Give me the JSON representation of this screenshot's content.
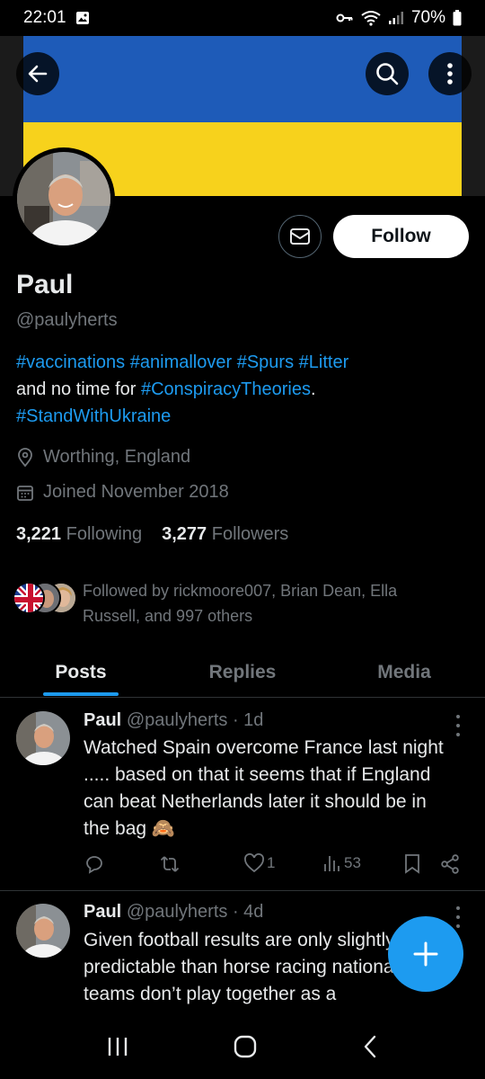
{
  "status_bar": {
    "time": "22:01",
    "battery": "70%"
  },
  "banner": {
    "top_color": "#1e5bb8",
    "bottom_color": "#f7d21c"
  },
  "header_buttons": {
    "back_icon": "arrow-left-icon",
    "search_icon": "search-icon",
    "more_icon": "more-vertical-icon"
  },
  "profile": {
    "name": "Paul",
    "handle": "@paulyherts",
    "follow_label": "Follow",
    "bio": {
      "line1_tags": [
        "#vaccinations",
        "#animallover",
        "#Spurs",
        "#Litter"
      ],
      "line2_prefix": "and no time for ",
      "line2_tag": "#ConspiracyTheories",
      "line2_suffix": ".",
      "line3_tag": "#StandWithUkraine"
    },
    "location": "Worthing, England",
    "joined": "Joined November 2018",
    "following_count": "3,221",
    "following_label": "Following",
    "followers_count": "3,277",
    "followers_label": "Followers",
    "followed_by": "Followed by rickmoore007, Brian Dean, Ella Russell, and 997 others"
  },
  "tabs": [
    {
      "label": "Posts",
      "active": true
    },
    {
      "label": "Replies",
      "active": false
    },
    {
      "label": "Media",
      "active": false
    }
  ],
  "posts": [
    {
      "name": "Paul",
      "meta": "@paulyherts · 1d",
      "text": "Watched Spain overcome France last night ..... based on that it seems that if England can beat Netherlands later it should be in the bag 🙈",
      "likes": "1",
      "views": "53"
    },
    {
      "name": "Paul",
      "meta": "@paulyherts · 4d",
      "text": "Given football results are only slightly more predictable than horse racing national teams don’t play together as a"
    }
  ],
  "colors": {
    "accent": "#1d9bf0",
    "muted": "#71767b",
    "text": "#e7e9ea"
  }
}
